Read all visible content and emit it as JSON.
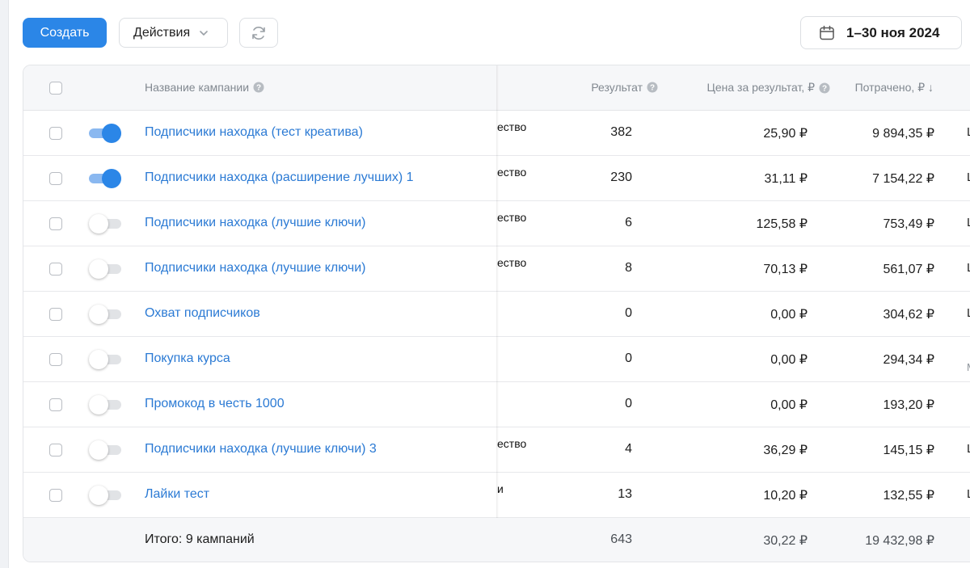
{
  "toolbar": {
    "create_label": "Создать",
    "actions_label": "Действия",
    "date_range": "1–30 ноя 2024"
  },
  "columns": {
    "name": "Название кампании",
    "result": "Результат",
    "price": "Цена за результат, ₽",
    "spent": "Потрачено, ₽ ↓"
  },
  "rows": [
    {
      "active": true,
      "name": "Подписчики находка (тест креатива)",
      "partial": "ество",
      "result": "382",
      "price": "25,90 ₽",
      "spent": "9 894,35 ₽",
      "edge": "L"
    },
    {
      "active": true,
      "name": "Подписчики находка (расширение лучших) 1",
      "partial": "ество",
      "result": "230",
      "price": "31,11 ₽",
      "spent": "7 154,22 ₽",
      "edge": "L"
    },
    {
      "active": false,
      "name": "Подписчики находка (лучшие ключи)",
      "partial": "ество",
      "result": "6",
      "price": "125,58 ₽",
      "spent": "753,49 ₽",
      "edge": "L"
    },
    {
      "active": false,
      "name": "Подписчики находка (лучшие ключи)",
      "partial": "ество",
      "result": "8",
      "price": "70,13 ₽",
      "spent": "561,07 ₽",
      "edge": "L"
    },
    {
      "active": false,
      "name": "Охват подписчиков",
      "partial": "",
      "result": "0",
      "price": "0,00 ₽",
      "spent": "304,62 ₽",
      "edge": "L"
    },
    {
      "active": false,
      "name": "Покупка курса",
      "partial": "",
      "result": "0",
      "price": "0,00 ₽",
      "spent": "294,34 ₽",
      "edge": "Ми"
    },
    {
      "active": false,
      "name": "Промокод в честь 1000",
      "partial": "",
      "result": "0",
      "price": "0,00 ₽",
      "spent": "193,20 ₽",
      "edge": ""
    },
    {
      "active": false,
      "name": "Подписчики находка (лучшие ключи) 3",
      "partial": "ество",
      "result": "4",
      "price": "36,29 ₽",
      "spent": "145,15 ₽",
      "edge": "L"
    },
    {
      "active": false,
      "name": "Лайки тест",
      "partial": "и",
      "result": "13",
      "price": "10,20 ₽",
      "spent": "132,55 ₽",
      "edge": "L"
    }
  ],
  "totals": {
    "label": "Итого: 9 кампаний",
    "result": "643",
    "price": "30,22 ₽",
    "spent": "19 432,98 ₽"
  }
}
